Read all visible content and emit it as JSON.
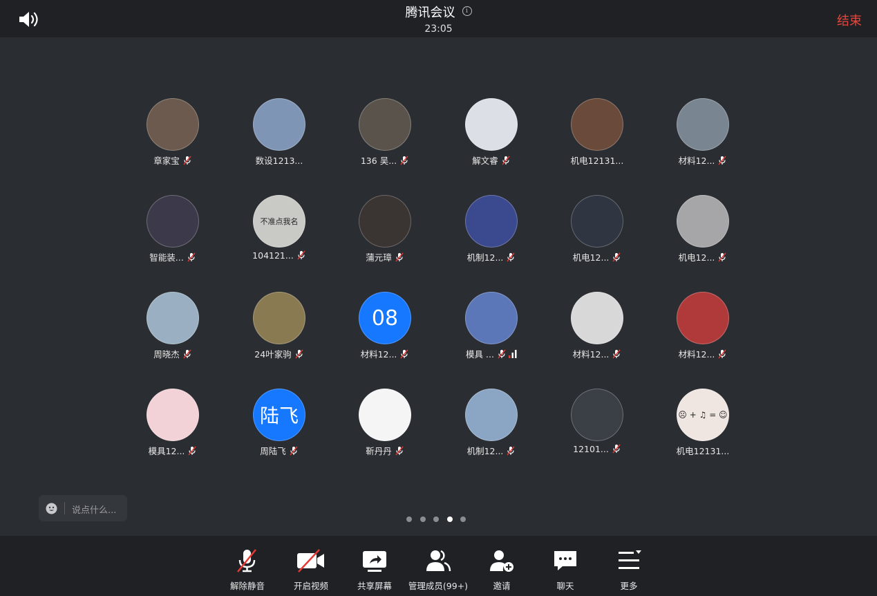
{
  "header": {
    "title": "腾讯会议",
    "info_glyph": "i",
    "time": "23:05",
    "end_label": "结束",
    "end_color": "#e8453c",
    "speaker_icon": "speaker-icon"
  },
  "members": [
    {
      "name": "章家宝",
      "muted": true,
      "bg": "#6b5a4d",
      "avatar_text": ""
    },
    {
      "name": "数设1213...",
      "muted": false,
      "bg": "#7f95b5",
      "avatar_text": ""
    },
    {
      "name": "136 吴...",
      "muted": true,
      "bg": "#5a534c",
      "avatar_text": ""
    },
    {
      "name": "解文睿",
      "muted": true,
      "bg": "#dcdfe6",
      "avatar_text": ""
    },
    {
      "name": "机电12131...",
      "muted": false,
      "bg": "#6a4a3a",
      "avatar_text": ""
    },
    {
      "name": "材料12...",
      "muted": true,
      "bg": "#7a8592",
      "avatar_text": ""
    },
    {
      "name": "智能装...",
      "muted": true,
      "bg": "#3c3a4a",
      "avatar_text": ""
    },
    {
      "name": "104121...",
      "muted": true,
      "bg": "#c9c9c6",
      "avatar_text": "不准点我名"
    },
    {
      "name": "蒲元璋",
      "muted": true,
      "bg": "#3a3533",
      "avatar_text": ""
    },
    {
      "name": "机制12...",
      "muted": true,
      "bg": "#3b4a8e",
      "avatar_text": ""
    },
    {
      "name": "机电12...",
      "muted": true,
      "bg": "#2f3642",
      "avatar_text": ""
    },
    {
      "name": "机电12...",
      "muted": true,
      "bg": "#a6a6a8",
      "avatar_text": ""
    },
    {
      "name": "周晓杰",
      "muted": true,
      "bg": "#9ab0c2",
      "avatar_text": ""
    },
    {
      "name": "24叶家驹",
      "muted": true,
      "bg": "#8a7a52",
      "avatar_text": ""
    },
    {
      "name": "材料12...",
      "muted": true,
      "bg": "#1677ff",
      "avatar_text": "08"
    },
    {
      "name": "模具 ...",
      "muted": true,
      "bg": "#5b77b8",
      "avatar_text": "",
      "signal": true
    },
    {
      "name": "材料12...",
      "muted": true,
      "bg": "#d8d8d8",
      "avatar_text": ""
    },
    {
      "name": "材料12...",
      "muted": true,
      "bg": "#b03a3a",
      "avatar_text": ""
    },
    {
      "name": "模具12...",
      "muted": true,
      "bg": "#f2d2d6",
      "avatar_text": ""
    },
    {
      "name": "周陆飞",
      "muted": true,
      "bg": "#1677ff",
      "avatar_text": "陆飞"
    },
    {
      "name": "靳丹丹",
      "muted": true,
      "bg": "#f5f5f5",
      "avatar_text": ""
    },
    {
      "name": "机制12...",
      "muted": true,
      "bg": "#8aa6c4",
      "avatar_text": ""
    },
    {
      "name": "12101...",
      "muted": true,
      "bg": "#3a4046",
      "avatar_text": ""
    },
    {
      "name": "机电12131...",
      "muted": false,
      "bg": "#efe6e2",
      "avatar_text": "☹ + ♫ = ☺"
    }
  ],
  "chat": {
    "placeholder": "说点什么...",
    "emoji_icon": "smiley-icon"
  },
  "pager": {
    "count": 5,
    "active": 4
  },
  "toolbar": [
    {
      "label": "解除静音",
      "icon": "mic-muted-icon"
    },
    {
      "label": "开启视频",
      "icon": "camera-off-icon"
    },
    {
      "label": "共享屏幕",
      "icon": "share-screen-icon"
    },
    {
      "label": "管理成员(99+)",
      "icon": "members-icon"
    },
    {
      "label": "邀请",
      "icon": "invite-icon"
    },
    {
      "label": "聊天",
      "icon": "chat-icon"
    },
    {
      "label": "更多",
      "icon": "more-icon"
    }
  ]
}
